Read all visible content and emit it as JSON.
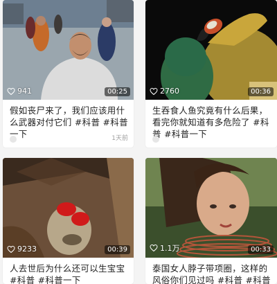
{
  "cards": [
    {
      "likes": "941",
      "duration": "00:25",
      "title": "假如丧尸来了，我们应该用什么武器对付它们 #科普 #科普一下",
      "time": "1天前"
    },
    {
      "likes": "2760",
      "duration": "00:36",
      "title": "生吞食人鱼究竟有什么后果，看完你就知道有多危险了 #科普 #科普一下",
      "time": ""
    },
    {
      "likes": "9233",
      "duration": "00:39",
      "title": "人去世后为什么还可以生宝宝 #科普 #科普一下",
      "time": ""
    },
    {
      "likes": "1.1万",
      "duration": "00:33",
      "title": "泰国女人脖子带项圈，这样的风俗你们见过吗 #科普 #科普一下",
      "time": ""
    }
  ],
  "icons": {
    "like": "heart-outline-icon"
  }
}
